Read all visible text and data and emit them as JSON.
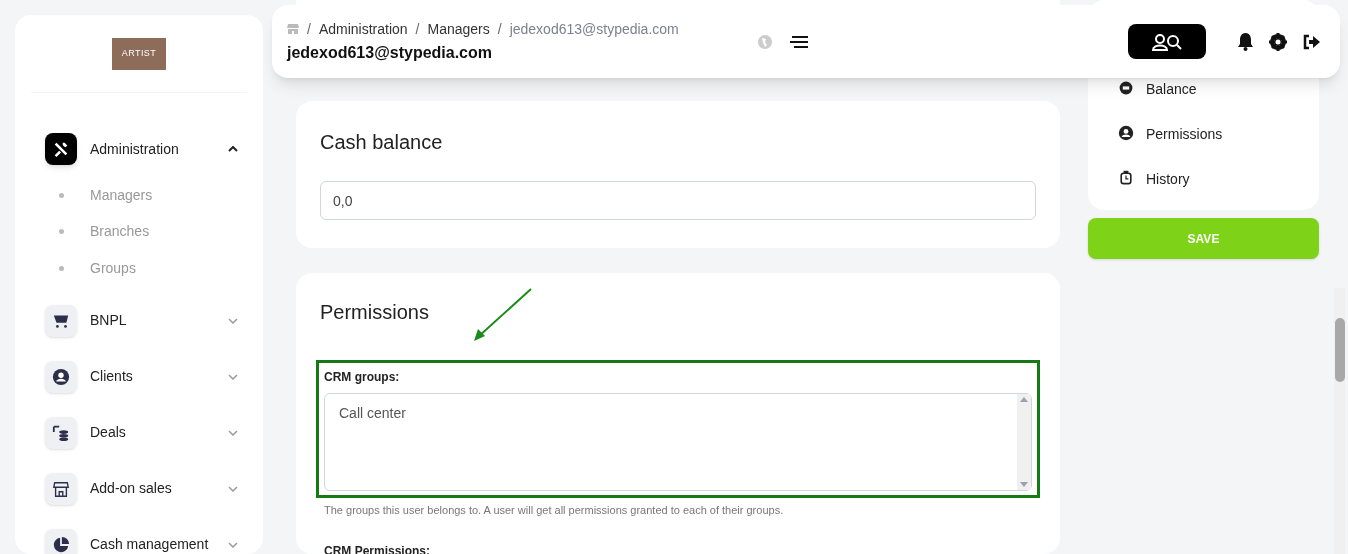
{
  "sidebar": {
    "logo": "ARTIST",
    "items": [
      {
        "label": "Administration",
        "kind": "tools",
        "selected": true,
        "expanded": true,
        "children": [
          {
            "label": "Managers"
          },
          {
            "label": "Branches"
          },
          {
            "label": "Groups"
          }
        ]
      },
      {
        "label": "BNPL",
        "kind": "cart",
        "selected": false,
        "expanded": false
      },
      {
        "label": "Clients",
        "kind": "user",
        "selected": false,
        "expanded": false
      },
      {
        "label": "Deals",
        "kind": "coins",
        "selected": false,
        "expanded": false
      },
      {
        "label": "Add-on sales",
        "kind": "store",
        "selected": false,
        "expanded": false
      },
      {
        "label": "Cash management",
        "kind": "pie",
        "selected": false,
        "expanded": false
      }
    ]
  },
  "header": {
    "separators": [
      "/",
      "/",
      "/"
    ],
    "breadcrumbs": [
      "Administration",
      "Managers",
      "jedexod613@stypedia.com"
    ],
    "title": "jedexod613@stypedia.com"
  },
  "cash_balance": {
    "title": "Cash balance",
    "value": "0,0"
  },
  "permissions": {
    "title": "Permissions",
    "crm_groups": {
      "label": "CRM groups:",
      "options": [
        "Call center"
      ],
      "help": "The groups this user belongs to. A user will get all permissions granted to each of their groups."
    },
    "crm_permissions": {
      "label": "CRM Permissions:"
    }
  },
  "side_nav": {
    "items": [
      {
        "label": "Balance",
        "kind": "wallet"
      },
      {
        "label": "Permissions",
        "kind": "user"
      },
      {
        "label": "History",
        "kind": "watch"
      }
    ],
    "save": "SAVE"
  }
}
